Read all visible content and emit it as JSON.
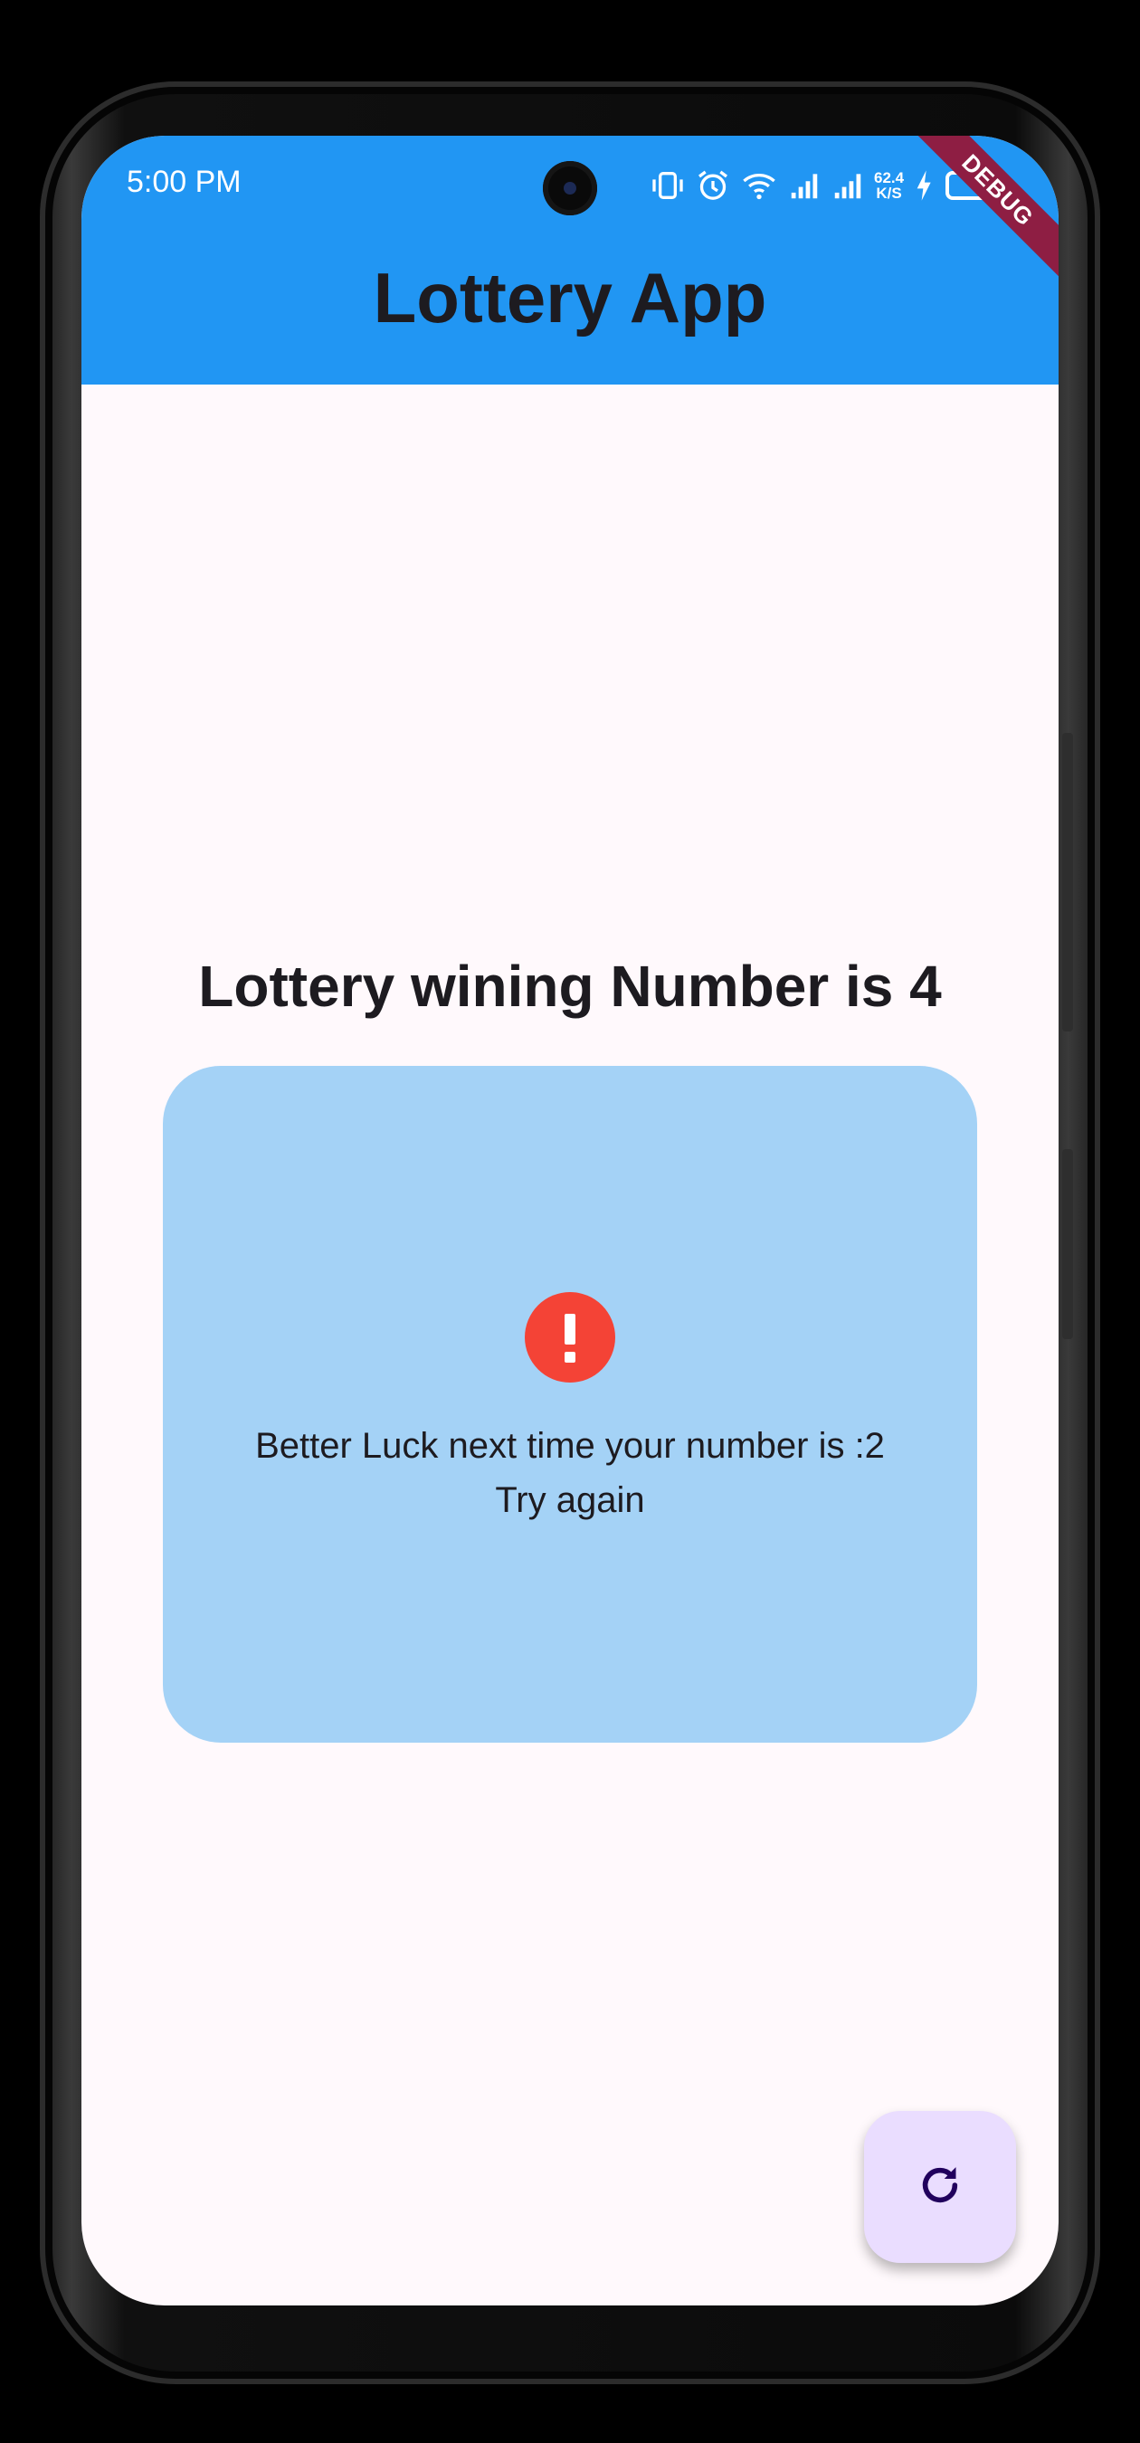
{
  "status_bar": {
    "time": "5:00 PM",
    "network_speed_value": "62.4",
    "network_speed_unit": "K/S",
    "icons": [
      "vibrate-icon",
      "alarm-icon",
      "wifi-icon",
      "signal-icon",
      "signal-icon",
      "charging-icon",
      "battery-icon"
    ]
  },
  "debug_banner": "DEBUG",
  "app_bar": {
    "title": "Lottery App",
    "background": "#2196F3"
  },
  "main": {
    "winning_heading": "Lottery wining Number is 4",
    "result_card": {
      "icon": "error-icon",
      "message_line1": "Better Luck next time your number is :2",
      "message_line2": "Try again",
      "background": "#A4D2F6",
      "icon_color": "#F44336"
    }
  },
  "fab": {
    "icon": "refresh-icon",
    "background": "#EADDFF"
  }
}
